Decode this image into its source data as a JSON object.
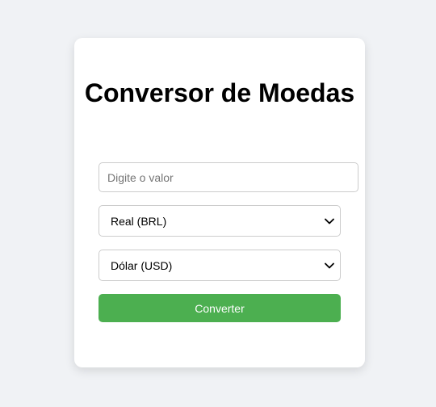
{
  "converter": {
    "title": "Conversor de Moedas",
    "amount_placeholder": "Digite o valor",
    "amount_value": "",
    "from_currency": "Real (BRL)",
    "to_currency": "Dólar (USD)",
    "convert_label": "Converter"
  },
  "icons": {
    "select_arrow": "chevron-down-icon"
  },
  "colors": {
    "page_background": "#f0f2f5",
    "card_background": "#ffffff",
    "button_background": "#4caf50",
    "button_text": "#ffffff",
    "field_border": "#cccccc"
  }
}
